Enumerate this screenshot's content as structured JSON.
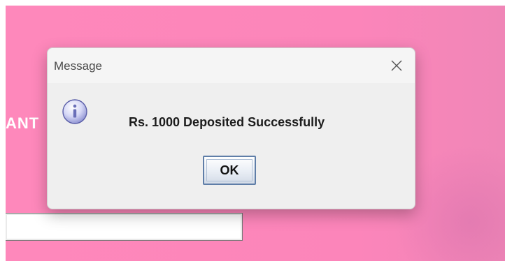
{
  "background": {
    "label_partial": "ANT",
    "colors": {
      "brand_pink": "#fe88bb"
    }
  },
  "dialog": {
    "title": "Message",
    "icon": "info-icon",
    "message": "Rs. 1000 Deposited Successfully",
    "ok_label": "OK",
    "close_icon": "close-icon"
  }
}
